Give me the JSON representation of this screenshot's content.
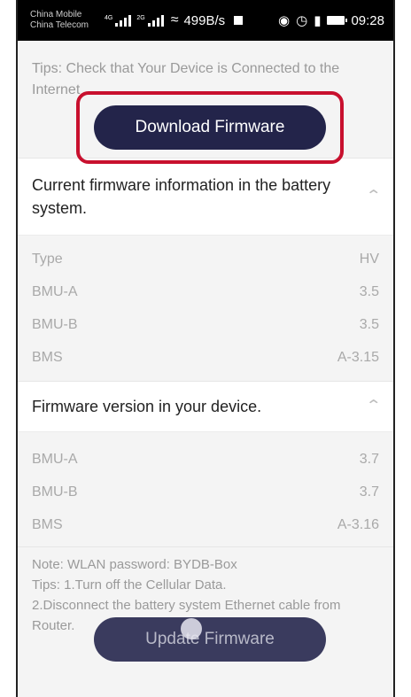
{
  "status_bar": {
    "carrier_1": "China Mobile",
    "carrier_2": "China Telecom",
    "net_1": "4G",
    "net_2": "2G",
    "speed": "499B/s",
    "time": "09:28"
  },
  "tips": {
    "text": "Tips: Check that Your Device is Connected to the Internet"
  },
  "download_button": {
    "label": "Download Firmware"
  },
  "battery_firmware": {
    "title": "Current firmware information in the battery system.",
    "rows": [
      {
        "label": "Type",
        "value": "HV"
      },
      {
        "label": "BMU-A",
        "value": "3.5"
      },
      {
        "label": "BMU-B",
        "value": "3.5"
      },
      {
        "label": "BMS",
        "value": "A-3.15"
      }
    ]
  },
  "device_firmware": {
    "title": "Firmware version in your device.",
    "rows": [
      {
        "label": "BMU-A",
        "value": "3.7"
      },
      {
        "label": "BMU-B",
        "value": "3.7"
      },
      {
        "label": "BMS",
        "value": "A-3.16"
      }
    ]
  },
  "notes": {
    "line1": "Note: WLAN password: BYDB-Box",
    "line2": "Tips: 1.Turn off the Cellular Data.",
    "line3": "2.Disconnect the battery system Ethernet cable from Router."
  },
  "update_button": {
    "label": "Update Firmware"
  },
  "colors": {
    "button": "#23244a",
    "highlight": "#c8102e"
  },
  "icons": [
    "signal-icon",
    "wifi-icon",
    "eye-icon",
    "alarm-icon",
    "vibrate-icon",
    "battery-icon",
    "chevron-up-icon"
  ]
}
